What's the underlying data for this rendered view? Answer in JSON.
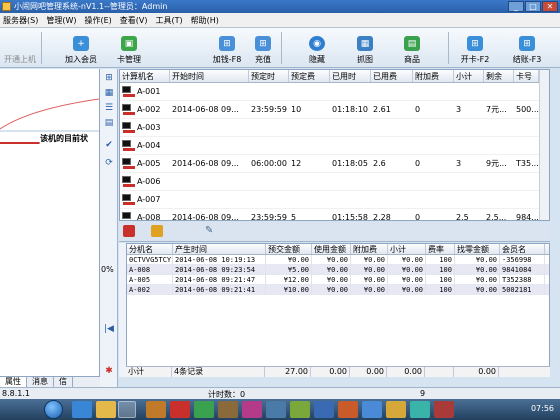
{
  "window": {
    "title": "小闹网吧管理系统-nV1.1--管理员：Admin",
    "btn_min": "_",
    "btn_max": "□",
    "btn_close": "✕"
  },
  "menu": [
    "服务器(S)",
    "管理(W)",
    "操作(E)",
    "查看(V)",
    "工具(T)",
    "帮助(H)"
  ],
  "toolbar": {
    "start_machine": "开通上机",
    "add_member": "加入会员",
    "card_manage": "卡管理",
    "add_time": "加钱-F8",
    "recharge": "充值",
    "hide": "隐藏",
    "capture": "抓图",
    "goods": "商品",
    "open_card": "开卡-F2",
    "checkout": "结账-F3"
  },
  "left_panel": {
    "text": "该机的目前状",
    "percent": "0%",
    "tabs": [
      "属性",
      "消息",
      "信"
    ]
  },
  "machines": {
    "headers": [
      "计算机名",
      "开始时间",
      "预定时",
      "预定费",
      "已用时",
      "已用费",
      "附加费",
      "小计",
      "剩余",
      "卡号"
    ],
    "rows": [
      {
        "name": "A-001",
        "start": "",
        "planned": "",
        "fee": "",
        "used": "",
        "used_fee": "",
        "extra": "",
        "sub": "",
        "remain": "",
        "card": ""
      },
      {
        "name": "A-002",
        "start": "2014-06-08 09...",
        "planned": "23:59:59",
        "fee": "10",
        "used": "01:18:10",
        "used_fee": "2.61",
        "extra": "0",
        "sub": "3",
        "remain": "7元...",
        "card": "500..."
      },
      {
        "name": "A-003",
        "start": "",
        "planned": "",
        "fee": "",
        "used": "",
        "used_fee": "",
        "extra": "",
        "sub": "",
        "remain": "",
        "card": ""
      },
      {
        "name": "A-004",
        "start": "",
        "planned": "",
        "fee": "",
        "used": "",
        "used_fee": "",
        "extra": "",
        "sub": "",
        "remain": "",
        "card": ""
      },
      {
        "name": "A-005",
        "start": "2014-06-08 09...",
        "planned": "06:00:00",
        "fee": "12",
        "used": "01:18:05",
        "used_fee": "2.6",
        "extra": "0",
        "sub": "3",
        "remain": "9元...",
        "card": "T35..."
      },
      {
        "name": "A-006",
        "start": "",
        "planned": "",
        "fee": "",
        "used": "",
        "used_fee": "",
        "extra": "",
        "sub": "",
        "remain": "",
        "card": ""
      },
      {
        "name": "A-007",
        "start": "",
        "planned": "",
        "fee": "",
        "used": "",
        "used_fee": "",
        "extra": "",
        "sub": "",
        "remain": "",
        "card": ""
      },
      {
        "name": "A-008",
        "start": "2014-06-08 09...",
        "planned": "23:59:59",
        "fee": "5",
        "used": "01:15:58",
        "used_fee": "2.28",
        "extra": "0",
        "sub": "2.5",
        "remain": "2.5...",
        "card": "984..."
      }
    ]
  },
  "records": {
    "headers": [
      "分机名",
      "产生时间",
      "预交金额",
      "使用金额",
      "附加费",
      "小计",
      "费率",
      "找零金额",
      "会员名"
    ],
    "rows": [
      {
        "pc": "0CTVVG5TCY",
        "time": "2014-06-08 10:19:13",
        "prepay": "¥0.00",
        "used": "¥0.00",
        "extra": "¥0.00",
        "sub": "¥0.00",
        "rate": "100",
        "change": "¥0.00",
        "member": "-356998"
      },
      {
        "pc": "A-008",
        "time": "2014-06-08 09:23:54",
        "prepay": "¥5.00",
        "used": "¥0.00",
        "extra": "¥0.00",
        "sub": "¥0.00",
        "rate": "100",
        "change": "¥0.00",
        "member": "9841084"
      },
      {
        "pc": "A-005",
        "time": "2014-06-08 09:21:47",
        "prepay": "¥12.00",
        "used": "¥0.00",
        "extra": "¥0.00",
        "sub": "¥0.00",
        "rate": "100",
        "change": "¥0.00",
        "member": "T352388"
      },
      {
        "pc": "A-002",
        "time": "2014-06-08 09:21:41",
        "prepay": "¥10.00",
        "used": "¥0.00",
        "extra": "¥0.00",
        "sub": "¥0.00",
        "rate": "100",
        "change": "¥0.00",
        "member": "5002181"
      }
    ],
    "subtotal": {
      "label": "小计",
      "count": "4条记录",
      "prepay": "27.00",
      "used": "0.00",
      "extra": "0.00",
      "sub": "0.00",
      "change": "0.00"
    }
  },
  "statusbar": {
    "left": "8.8.1.1",
    "count": "计时数：0",
    "num": "9"
  },
  "taskbar": {
    "clock": "07:56"
  },
  "colors": {
    "accent": "#2a5fa8",
    "selection": "#3399ff",
    "red": "#c9302c"
  }
}
